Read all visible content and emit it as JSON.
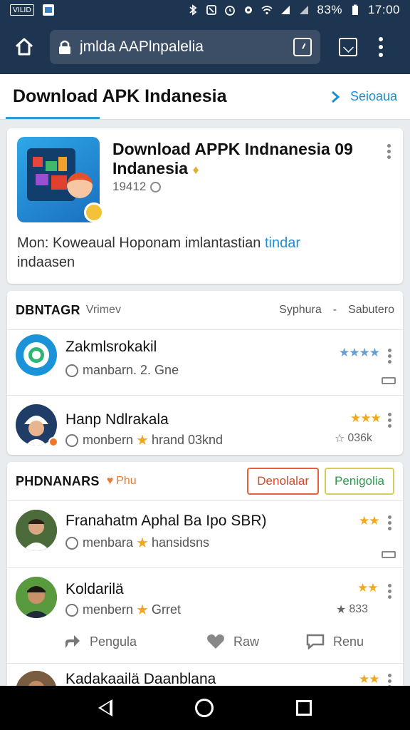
{
  "status_bar": {
    "left_badge": "VILID",
    "battery_text": "83%",
    "time": "17:00"
  },
  "browser": {
    "url": "jmlda AAPlnpalelia"
  },
  "header": {
    "title": "Download APK Indanesia",
    "action_label": "Seioaua"
  },
  "app_card": {
    "title": "Download APPK Indnanesia 0",
    "title_line2": "Indanesia",
    "title_suffix": "9",
    "size": "19412",
    "description": "Mon: Koweaual Hoponam imlantastian",
    "description_link": "tindar",
    "description_line2": "indaasen"
  },
  "section1": {
    "title": "DBNTAGR",
    "subtitle": "Vrimev",
    "right_1": "Syphura",
    "right_sep": "-",
    "right_2": "Sabutero",
    "rows": [
      {
        "name": "Zakmlsrokakil",
        "sub": "manbarn. 2. Gne",
        "stars": "★★★★"
      },
      {
        "name": "Hanp Ndlrakala",
        "sub_a": "monbern",
        "sub_b": "hrand 03knd",
        "stars": "★★★",
        "count": "036k"
      }
    ]
  },
  "section2": {
    "title": "PHDNANARS",
    "tag_label": "Phu",
    "button_1": "Denolalar",
    "button_2": "Penigolia",
    "rows": [
      {
        "name": "Franahatm Aphal Ba Ipo SBR)",
        "sub_a": "menbara",
        "sub_b": "hansidsns",
        "stars": "★★"
      },
      {
        "name": "Koldarilä",
        "sub_a": "menbern",
        "sub_b": "Grret",
        "stars": "★★",
        "count": "833"
      },
      {
        "name": "Kadakaailä Daanblana",
        "stars": "★★"
      }
    ],
    "actions": {
      "share": "Pengula",
      "like": "Raw",
      "comment": "Renu"
    }
  },
  "colors": {
    "appbar": "#1d3550",
    "accent": "#2d9bd4",
    "star_gold": "#f0a81c",
    "star_blue": "#6a9fd0"
  }
}
